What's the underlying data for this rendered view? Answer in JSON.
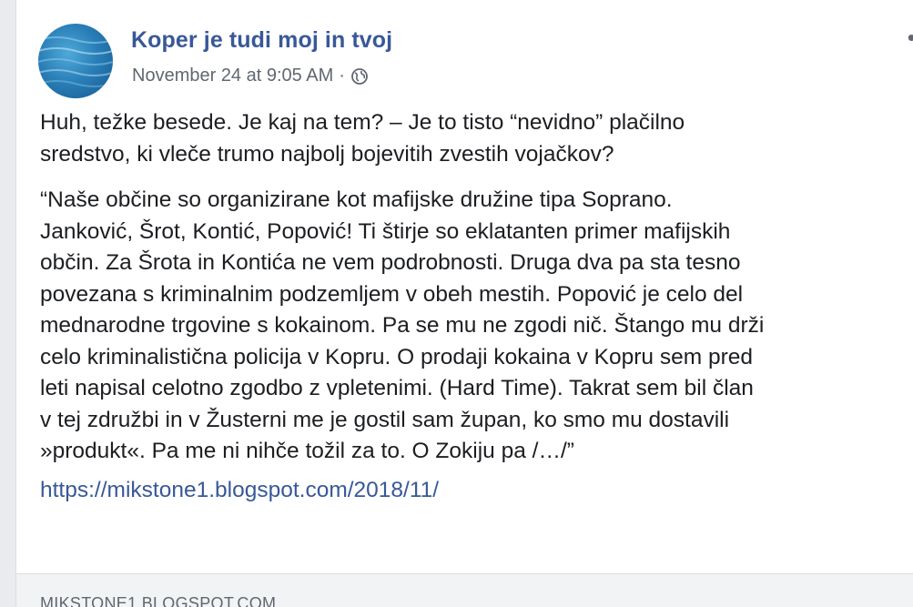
{
  "post": {
    "page_name": "Koper je tudi moj in tvoj",
    "timestamp": "November 24 at 9:05 AM",
    "separator": "·",
    "privacy_icon": "globe-icon",
    "more_icon": "more-options-icon",
    "intro_text": "Huh, težke besede. Je kaj na tem? – Je to tisto “nevidno” plačilno\nsredstvo, ki vleče trumo najbolj bojevitih zvestih vojačkov?",
    "quote_text": "“Naše občine so organizirane kot mafijske družine tipa Soprano.\nJanković, Šrot, Kontić, Popović! Ti štirje so eklatanten primer mafijskih\nobčin. Za Šrota in Kontića ne vem podrobnosti. Druga dva pa sta tesno\npovezana s kriminalnim podzemljem v obeh mestih. Popović je celo del\nmednarodne trgovine s kokainom. Pa se mu ne zgodi nič. Štango mu drži\ncelo kriminalistična policija v Kopru. O prodaji kokaina v Kopru sem pred\nleti napisal celotno zgodbo z vpletenimi. (Hard Time). Takrat sem bil član\nv tej združbi in v Žusterni me je gostil sam župan, ko smo mu dostavili\n»produkt«. Pa me ni nihče tožil za to. O Zokiju pa /…/”",
    "link": "https://mikstone1.blogspot.com/2018/11/",
    "preview_domain": "MIKSTONE1.BLOGSPOT.COM"
  },
  "colors": {
    "link": "#385898",
    "text": "#1c1e21",
    "meta": "#616770",
    "background": "#e9ebee"
  }
}
